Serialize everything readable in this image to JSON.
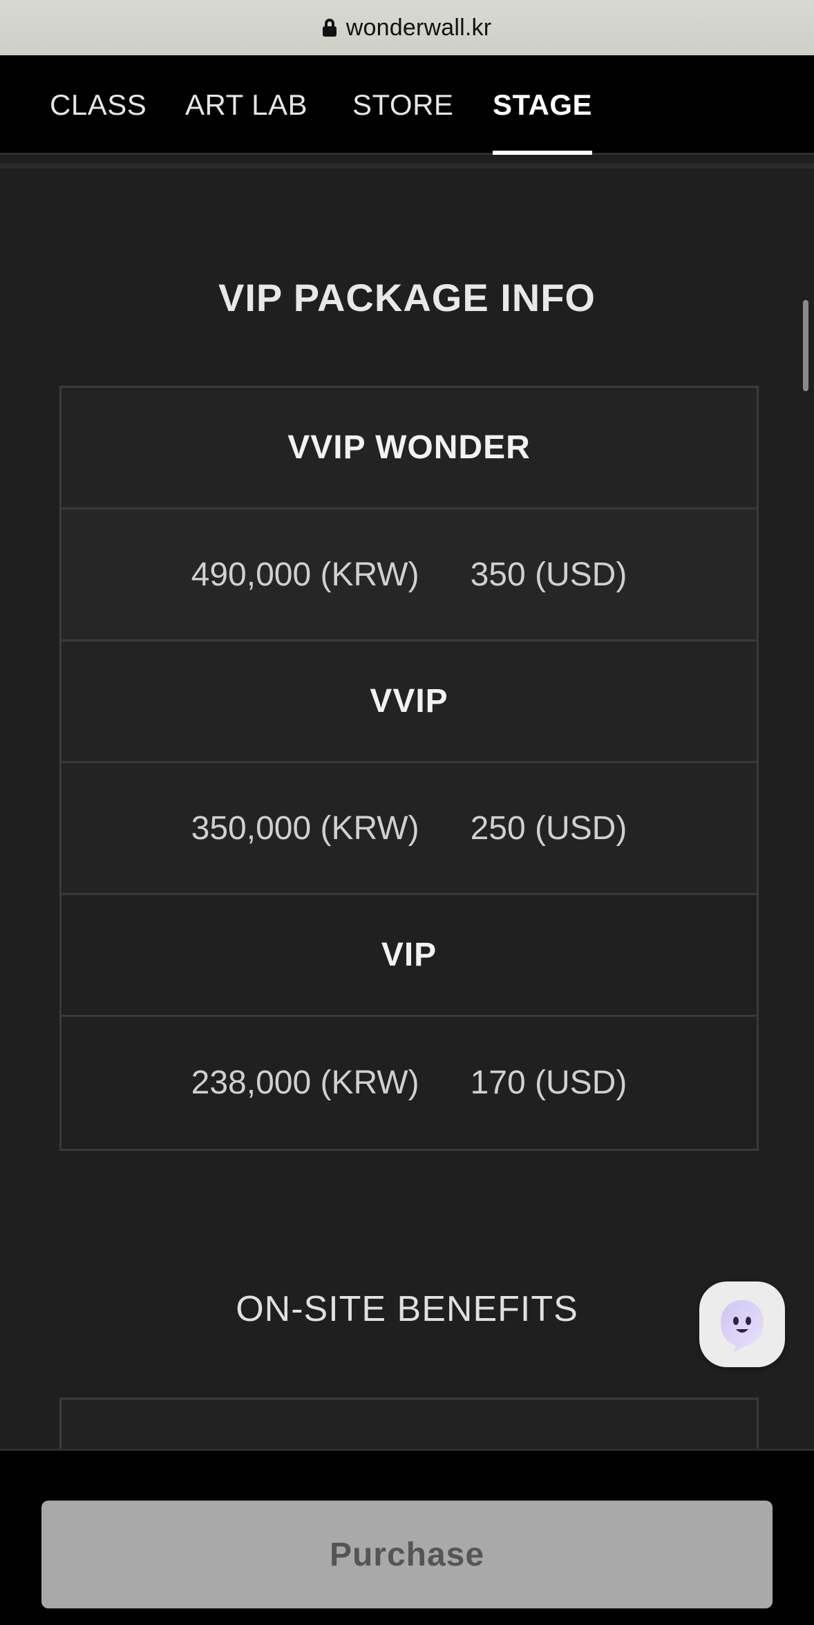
{
  "browser": {
    "url": "wonderwall.kr"
  },
  "nav": {
    "items": [
      {
        "label": "CLASS",
        "active": false
      },
      {
        "label": "ART LAB",
        "active": false
      },
      {
        "label": "STORE",
        "active": false
      },
      {
        "label": "STAGE",
        "active": true
      }
    ]
  },
  "vip_section": {
    "title": "VIP PACKAGE INFO",
    "packages": [
      {
        "name": "VVIP WONDER",
        "price_krw": "490,000 (KRW)",
        "price_usd": "350 (USD)"
      },
      {
        "name": "VVIP",
        "price_krw": "350,000 (KRW)",
        "price_usd": "250 (USD)"
      },
      {
        "name": "VIP",
        "price_krw": "238,000 (KRW)",
        "price_usd": "170 (USD)"
      }
    ]
  },
  "benefits_section": {
    "title": "ON-SITE BENEFITS"
  },
  "chat_button": {
    "icon": "ghost-chat-icon"
  },
  "footer": {
    "purchase_label": "Purchase"
  },
  "colors": {
    "background": "#1f1f1f",
    "nav_background": "#000000",
    "button_disabled": "#a9a9a9"
  }
}
